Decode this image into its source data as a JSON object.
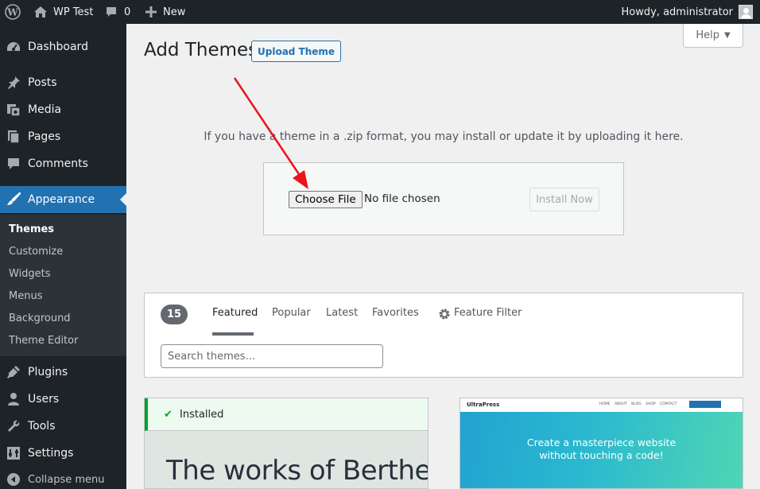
{
  "admin_bar": {
    "site_name": "WP Test",
    "comments_count": "0",
    "new_label": "New",
    "howdy": "Howdy, administrator"
  },
  "sidebar": {
    "items": [
      {
        "label": "Dashboard",
        "icon": "dashboard-icon"
      },
      {
        "label": "Posts",
        "icon": "pin-icon"
      },
      {
        "label": "Media",
        "icon": "media-icon"
      },
      {
        "label": "Pages",
        "icon": "pages-icon"
      },
      {
        "label": "Comments",
        "icon": "comment-icon"
      },
      {
        "label": "Appearance",
        "icon": "paintbrush-icon"
      },
      {
        "label": "Plugins",
        "icon": "plug-icon"
      },
      {
        "label": "Users",
        "icon": "user-icon"
      },
      {
        "label": "Tools",
        "icon": "wrench-icon"
      },
      {
        "label": "Settings",
        "icon": "settings-icon"
      },
      {
        "label": "Collapse menu",
        "icon": "collapse-icon"
      }
    ],
    "submenu": [
      "Themes",
      "Customize",
      "Widgets",
      "Menus",
      "Background",
      "Theme Editor"
    ]
  },
  "main": {
    "title": "Add Themes",
    "upload_button": "Upload Theme",
    "help_button": "Help",
    "upload_help": "If you have a theme in a .zip format, you may install or update it by uploading it here.",
    "choose_file": "Choose File",
    "no_file": "No file chosen",
    "install_now": "Install Now"
  },
  "filter": {
    "count": "15",
    "tabs": [
      "Featured",
      "Popular",
      "Latest",
      "Favorites"
    ],
    "feature_filter": "Feature Filter",
    "search_placeholder": "Search themes..."
  },
  "themes": [
    {
      "installed_label": "Installed",
      "preview_text": "The works of Berthe"
    },
    {
      "logo": "UltraPress",
      "nav_links": "HOME ABOUT BLOG SHOP CONTACT",
      "headline_1": "Create a masterpiece website",
      "headline_2": "without touching a code!"
    }
  ],
  "colors": {
    "accent": "#2271b1",
    "admin_dark": "#1d2327",
    "installed_green": "#00a32a",
    "arrow": "#e8141b"
  }
}
